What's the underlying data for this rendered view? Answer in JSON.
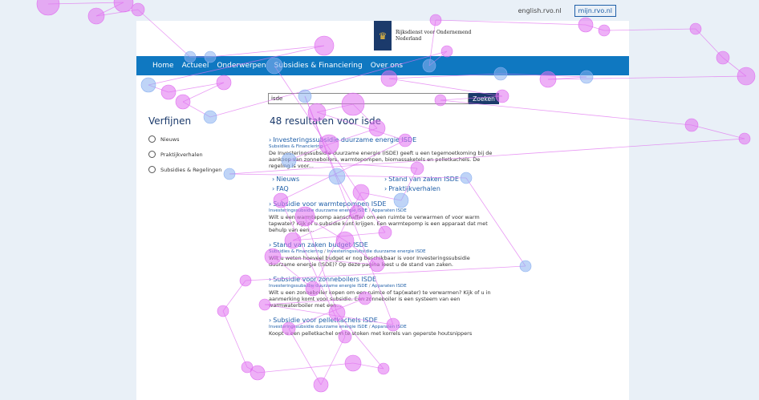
{
  "top_links": [
    "english.rvo.nl",
    "mijn.rvo.nl"
  ],
  "logo": {
    "line1": "Rijksdienst voor Ondernemend",
    "line2": "Nederland"
  },
  "nav": [
    "Home",
    "Actueel",
    "Onderwerpen",
    "Subsidies & Financiering",
    "Over ons"
  ],
  "search": {
    "value": "isde",
    "button": "Zoeken"
  },
  "sidebar": {
    "title": "Verfijnen",
    "filters": [
      "Nieuws",
      "Praktijkverhalen",
      "Subsidies & Regelingen"
    ]
  },
  "results_heading": "48 resultaten voor isde",
  "results": [
    {
      "title": "Investeringssubsidie duurzame energie ISDE",
      "crumbs": [
        "Subsidies & Financiering"
      ],
      "snippet": "De Investeringssubsidie duurzame energie (ISDE) geeft u een tegemoetkoming bij de aankoop van zonneboilers, warmtepompen, biomassaketels en pelletkachels. De regeling is voor...",
      "sublinks": [
        "Nieuws",
        "Stand van zaken ISDE",
        "FAQ",
        "Praktijkverhalen"
      ]
    },
    {
      "title": "Subsidie voor warmtepompen ISDE",
      "crumbs": [
        "Investeringssubsidie duurzame energie ISDE",
        "Apparaten ISDE"
      ],
      "snippet": "Wilt u een warmtepomp aanschaffen om een ruimte te verwarmen of voor warm tapwater? Kijk of u subsidie kunt krijgen. Een warmtepomp is een apparaat dat met behulp van een..."
    },
    {
      "title": "Stand van zaken budget ISDE",
      "crumbs": [
        "Subsidies & Financiering",
        "Investeringssubsidie duurzame energie ISDE"
      ],
      "snippet": "Wilt u weten hoeveel budget er nog beschikbaar is voor Investeringssubsidie duurzame energie (ISDE)? Op deze pagina leest u de stand van zaken."
    },
    {
      "title": "Subsidie voor zonneboilers ISDE",
      "crumbs": [
        "Investeringssubsidie duurzame energie ISDE",
        "Apparaten ISDE"
      ],
      "snippet": "Wilt u een zonneboiler kopen om een ruimte of tap(water) te verwarmen? Kijk of u in aanmerking komt voor subsidie. Een zonneboiler is een systeem van een warmwaterboiler met een..."
    },
    {
      "title": "Subsidie voor pelletkachels ISDE",
      "crumbs": [
        "Investeringssubsidie duurzame energie ISDE",
        "Apparaten ISDE"
      ],
      "snippet": "Koopt u een pelletkachel om te stoken met korrels van geperste houtsnippers"
    }
  ],
  "colors": {
    "nav": "#0f78c1",
    "brand": "#1b3a6b",
    "link": "#1f5fa8",
    "gaze_fixation": "#e070f0",
    "gaze_alt": "#8ab0f0"
  }
}
